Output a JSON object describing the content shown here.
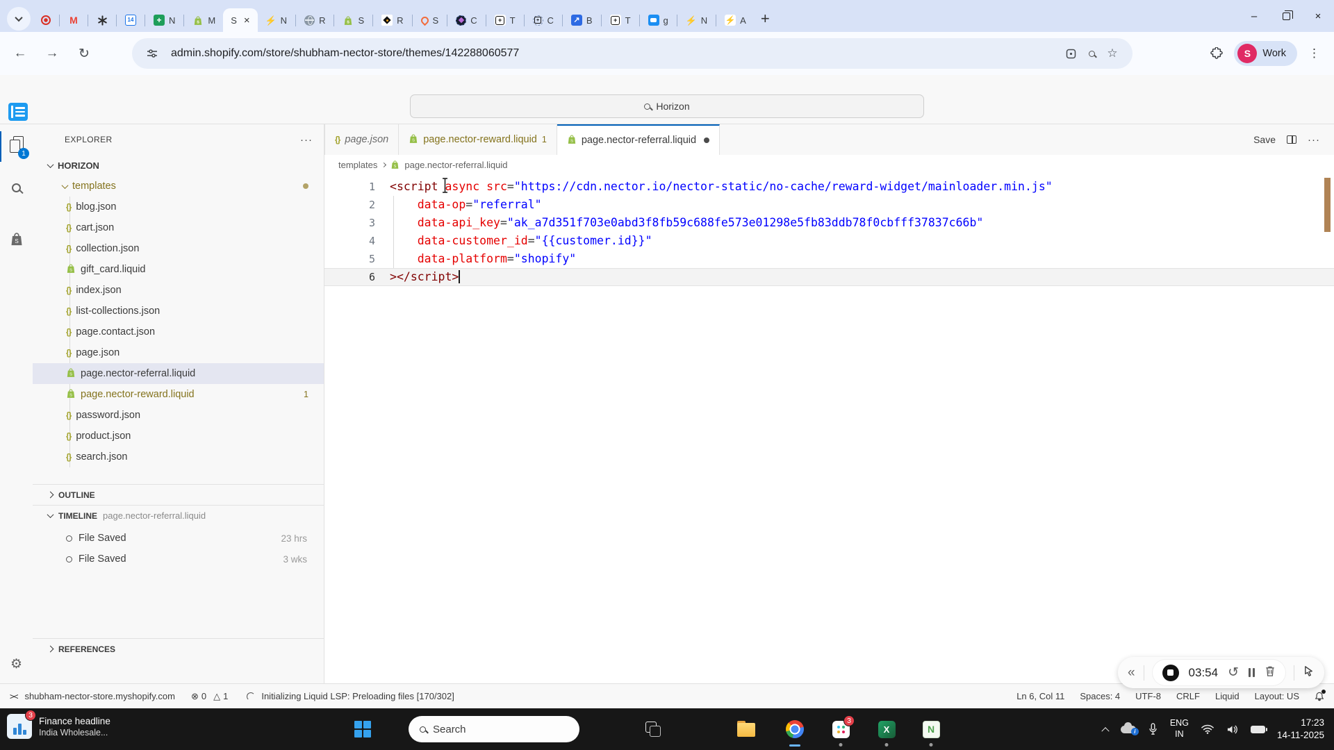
{
  "colors": {
    "accent_blue": "#005fb8",
    "shopify_green": "#95bf47",
    "git_modified": "#84731d",
    "tag_color": "#800000",
    "attr_color": "#e50000",
    "string_color": "#0000ff",
    "tabstrip_bg": "#d8e2f7",
    "taskbar_bg": "#171717"
  },
  "browser": {
    "url": "admin.shopify.com/store/shubham-nector-store/themes/142288060577",
    "profile": {
      "initial": "S",
      "label": "Work"
    },
    "tabs": [
      {
        "icon": "recorder",
        "label": ""
      },
      {
        "icon": "gmail",
        "label": ""
      },
      {
        "icon": "chatgpt",
        "label": ""
      },
      {
        "icon": "calendar",
        "label": ""
      },
      {
        "icon": "sheets",
        "label": "N"
      },
      {
        "icon": "shopify",
        "label": "M"
      },
      {
        "icon": "none",
        "label": "S",
        "active": true
      },
      {
        "icon": "lightning",
        "label": "N"
      },
      {
        "icon": "globe",
        "label": "R"
      },
      {
        "icon": "shopify",
        "label": "S"
      },
      {
        "icon": "diamond",
        "label": "R"
      },
      {
        "icon": "flame",
        "label": "S"
      },
      {
        "icon": "darkcircle",
        "label": "C"
      },
      {
        "icon": "plusbox",
        "label": "T"
      },
      {
        "icon": "dashcircle",
        "label": "C"
      },
      {
        "icon": "jira",
        "label": "B"
      },
      {
        "icon": "plusbox",
        "label": "T"
      },
      {
        "icon": "chat",
        "label": "g"
      },
      {
        "icon": "lightning",
        "label": "N"
      },
      {
        "icon": "lightbox",
        "label": "A"
      }
    ]
  },
  "editor": {
    "command_center": "Horizon",
    "activity_badge": "1",
    "explorer": {
      "title": "EXPLORER",
      "root": "HORIZON",
      "folder": "templates",
      "files": [
        {
          "name": "blog.json",
          "type": "json"
        },
        {
          "name": "cart.json",
          "type": "json"
        },
        {
          "name": "collection.json",
          "type": "json"
        },
        {
          "name": "gift_card.liquid",
          "type": "liquid"
        },
        {
          "name": "index.json",
          "type": "json"
        },
        {
          "name": "list-collections.json",
          "type": "json"
        },
        {
          "name": "page.contact.json",
          "type": "json"
        },
        {
          "name": "page.json",
          "type": "json"
        },
        {
          "name": "page.nector-referral.liquid",
          "type": "liquid",
          "selected": true
        },
        {
          "name": "page.nector-reward.liquid",
          "type": "liquid",
          "modified": true,
          "badge": "1"
        },
        {
          "name": "password.json",
          "type": "json"
        },
        {
          "name": "product.json",
          "type": "json"
        },
        {
          "name": "search.json",
          "type": "json"
        }
      ]
    },
    "sections": {
      "outline": "OUTLINE",
      "timeline": "TIMELINE",
      "timeline_file": "page.nector-referral.liquid",
      "timeline_items": [
        {
          "label": "File Saved",
          "time": "23 hrs"
        },
        {
          "label": "File Saved",
          "time": "3 wks"
        }
      ],
      "references": "REFERENCES"
    },
    "tabs": [
      {
        "name": "page.json",
        "type": "json",
        "preview": true
      },
      {
        "name": "page.nector-reward.liquid",
        "type": "liquid",
        "modified": true,
        "badge": "1"
      },
      {
        "name": "page.nector-referral.liquid",
        "type": "liquid",
        "active": true,
        "dirty": true
      }
    ],
    "actions": {
      "save": "Save"
    },
    "breadcrumb": {
      "folder": "templates",
      "file": "page.nector-referral.liquid"
    },
    "code_lines": [
      {
        "num": "1",
        "tokens": [
          {
            "c": "pu",
            "v": "<"
          },
          {
            "c": "tg",
            "v": "script"
          },
          {
            "c": "pl",
            "v": " "
          },
          {
            "c": "at",
            "v": "async"
          },
          {
            "c": "pl",
            "v": " "
          },
          {
            "c": "at",
            "v": "src"
          },
          {
            "c": "op",
            "v": "="
          },
          {
            "c": "st",
            "v": "\"https://cdn.nector.io/nector-static/no-cache/reward-widget/mainloader.min.js\""
          }
        ]
      },
      {
        "num": "2",
        "tokens": [
          {
            "c": "pl",
            "v": "    "
          },
          {
            "c": "at",
            "v": "data-op"
          },
          {
            "c": "op",
            "v": "="
          },
          {
            "c": "st",
            "v": "\"referral\""
          }
        ]
      },
      {
        "num": "3",
        "tokens": [
          {
            "c": "pl",
            "v": "    "
          },
          {
            "c": "at",
            "v": "data-api_key"
          },
          {
            "c": "op",
            "v": "="
          },
          {
            "c": "st",
            "v": "\"ak_a7d351f703e0abd3f8fb59c688fe573e01298e5fb83ddb78f0cbfff37837c66b\""
          }
        ]
      },
      {
        "num": "4",
        "tokens": [
          {
            "c": "pl",
            "v": "    "
          },
          {
            "c": "at",
            "v": "data-customer_id"
          },
          {
            "c": "op",
            "v": "="
          },
          {
            "c": "st",
            "v": "\"{{customer.id}}\""
          }
        ]
      },
      {
        "num": "5",
        "tokens": [
          {
            "c": "pl",
            "v": "    "
          },
          {
            "c": "at",
            "v": "data-platform"
          },
          {
            "c": "op",
            "v": "="
          },
          {
            "c": "st",
            "v": "\"shopify\""
          }
        ]
      },
      {
        "num": "6",
        "current": true,
        "tokens": [
          {
            "c": "pu",
            "v": ">"
          },
          {
            "c": "pu",
            "v": "<"
          },
          {
            "c": "pu",
            "v": "/"
          },
          {
            "c": "tg",
            "v": "script"
          },
          {
            "c": "pu",
            "v": ">"
          }
        ]
      }
    ],
    "status_bar": {
      "remote": "><",
      "host": "shubham-nector-store.myshopify.com",
      "errors": "0",
      "warnings": "1",
      "message": "Initializing Liquid LSP: Preloading files [170/302]",
      "cursor": "Ln 6, Col 11",
      "indent": "Spaces: 4",
      "encoding": "UTF-8",
      "eol": "CRLF",
      "language": "Liquid",
      "layout": "Layout: US"
    }
  },
  "recorder": {
    "time": "03:54"
  },
  "taskbar": {
    "widgets": {
      "headline": "Finance headline",
      "subline": "India Wholesale...",
      "badge": "3"
    },
    "search_label": "Search",
    "slack_badge": "3",
    "tray": {
      "lang_top": "ENG",
      "lang_bottom": "IN",
      "time": "17:23",
      "date": "14-11-2025"
    }
  }
}
